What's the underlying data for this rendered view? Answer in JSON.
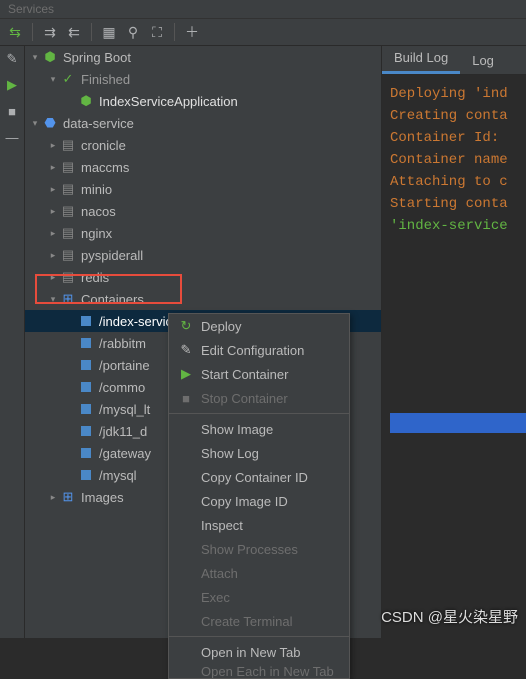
{
  "panel_title": "Services",
  "tree": {
    "spring_boot": "Spring Boot",
    "finished": "Finished",
    "app": "IndexServiceApplication",
    "data_service": "data-service",
    "items": [
      "cronicle",
      "maccms",
      "minio",
      "nacos",
      "nginx",
      "pyspiderall",
      "redis"
    ],
    "containers": "Containers",
    "c_items": [
      "/index-service",
      "/rabbitm",
      "/portaine",
      "/commo",
      "/mysql_lt",
      "/jdk11_d",
      "/gateway",
      "/mysql"
    ],
    "images": "Images"
  },
  "tabs": {
    "build_log": "Build Log",
    "log": "Log"
  },
  "console": [
    "Deploying 'ind",
    "Creating conta",
    "Container Id: ",
    "Container name",
    "Attaching to c",
    "Starting conta"
  ],
  "console_last": "'index-service",
  "menu": {
    "deploy": "Deploy",
    "edit": "Edit Configuration",
    "start": "Start Container",
    "stop": "Stop Container",
    "show_image": "Show Image",
    "show_log": "Show Log",
    "copy_cid": "Copy Container ID",
    "copy_iid": "Copy Image ID",
    "inspect": "Inspect",
    "procs": "Show Processes",
    "attach": "Attach",
    "exec": "Exec",
    "terminal": "Create Terminal",
    "open_tab": "Open in New Tab",
    "open_each": "Open Each in New Tab"
  },
  "watermark": "CSDN @星火染星野"
}
